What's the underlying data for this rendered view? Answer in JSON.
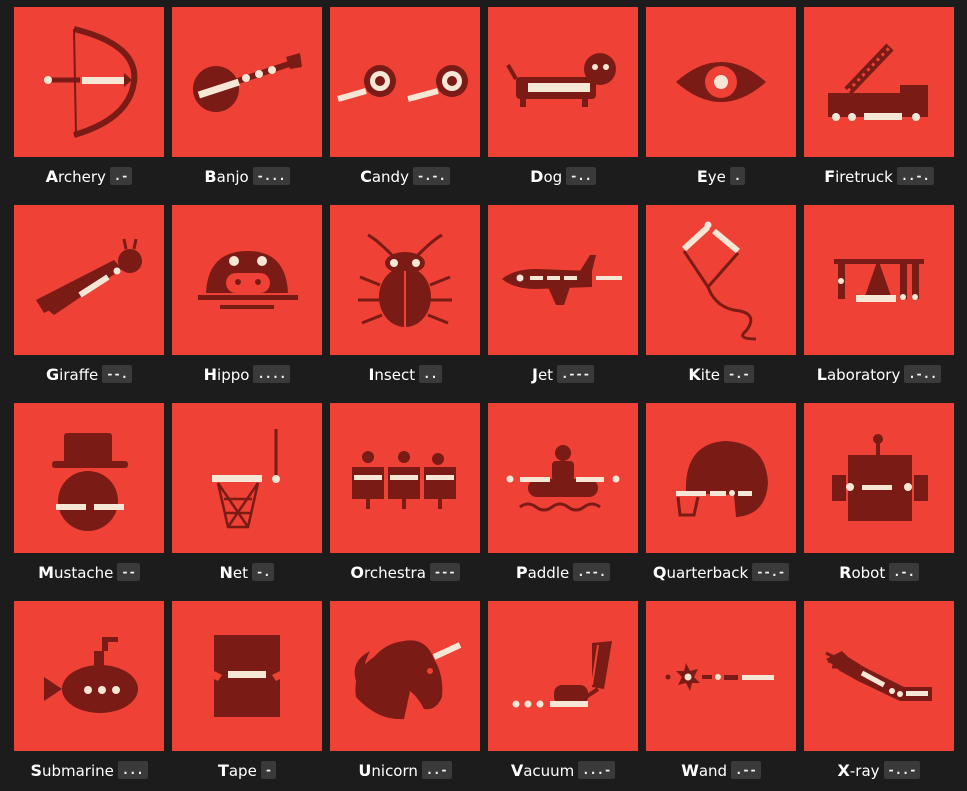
{
  "colors": {
    "tile": "#ef4136",
    "dark": "#7a1b16",
    "light": "#f6e6d6",
    "background": "#1c1c1c",
    "code_bg": "#3a3a3a"
  },
  "items": [
    {
      "first": "A",
      "rest": "rchery",
      "code": ".-",
      "icon": "archery-icon"
    },
    {
      "first": "B",
      "rest": "anjo",
      "code": "-...",
      "icon": "banjo-icon"
    },
    {
      "first": "C",
      "rest": "andy",
      "code": "-.-.",
      "icon": "candy-icon"
    },
    {
      "first": "D",
      "rest": "og",
      "code": "-..",
      "icon": "dog-icon"
    },
    {
      "first": "E",
      "rest": "ye",
      "code": ".",
      "icon": "eye-icon"
    },
    {
      "first": "F",
      "rest": "iretruck",
      "code": "..-.",
      "icon": "firetruck-icon"
    },
    {
      "first": "G",
      "rest": "iraffe",
      "code": "--.",
      "icon": "giraffe-icon"
    },
    {
      "first": "H",
      "rest": "ippo",
      "code": "....",
      "icon": "hippo-icon"
    },
    {
      "first": "I",
      "rest": "nsect",
      "code": "..",
      "icon": "insect-icon"
    },
    {
      "first": "J",
      "rest": "et",
      "code": ".---",
      "icon": "jet-icon"
    },
    {
      "first": "K",
      "rest": "ite",
      "code": "-.-",
      "icon": "kite-icon"
    },
    {
      "first": "L",
      "rest": "aboratory",
      "code": ".-..",
      "icon": "laboratory-icon"
    },
    {
      "first": "M",
      "rest": "ustache",
      "code": "--",
      "icon": "mustache-icon"
    },
    {
      "first": "N",
      "rest": "et",
      "code": "-.",
      "icon": "net-icon"
    },
    {
      "first": "O",
      "rest": "rchestra",
      "code": "---",
      "icon": "orchestra-icon"
    },
    {
      "first": "P",
      "rest": "addle",
      "code": ".--.",
      "icon": "paddle-icon"
    },
    {
      "first": "Q",
      "rest": "uarterback",
      "code": "--.-",
      "icon": "quarterback-icon"
    },
    {
      "first": "R",
      "rest": "obot",
      "code": ".-.",
      "icon": "robot-icon"
    },
    {
      "first": "S",
      "rest": "ubmarine",
      "code": "...",
      "icon": "submarine-icon"
    },
    {
      "first": "T",
      "rest": "ape",
      "code": "-",
      "icon": "tape-icon"
    },
    {
      "first": "U",
      "rest": "nicorn",
      "code": "..-",
      "icon": "unicorn-icon"
    },
    {
      "first": "V",
      "rest": "acuum",
      "code": "...-",
      "icon": "vacuum-icon"
    },
    {
      "first": "W",
      "rest": "and",
      "code": ".--",
      "icon": "wand-icon"
    },
    {
      "first": "X",
      "rest": "-ray",
      "code": "-..-",
      "icon": "x-ray-icon"
    }
  ]
}
